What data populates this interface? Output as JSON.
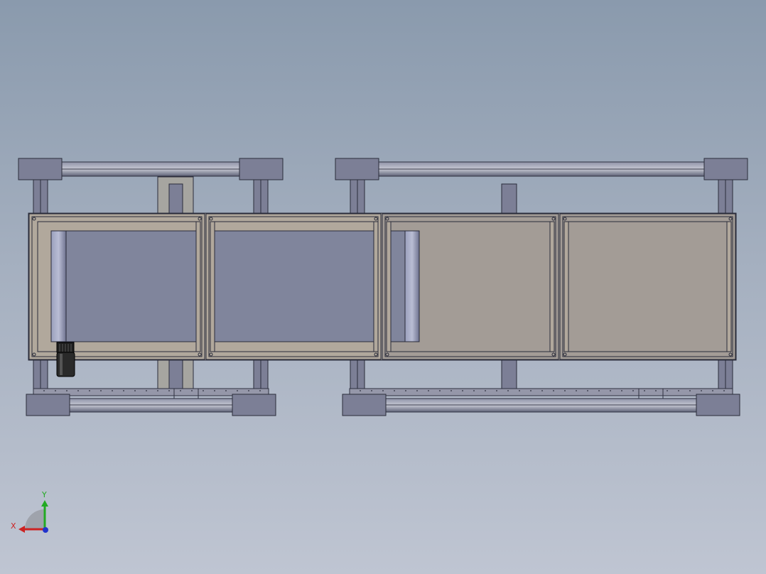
{
  "viewport": {
    "background_top": "#8a9aad",
    "background_bottom": "#bfc5d2"
  },
  "model": {
    "frame_color": "#7c7f96",
    "panel_border_color": "#b1a89c",
    "roller_section_color": "#80859c",
    "plate_color": "#a39c96",
    "motor_color": "#2a2a2a"
  },
  "triad": {
    "x_label": "X",
    "y_label": "Y",
    "x_color": "#cc2222",
    "y_color": "#22aa22",
    "z_color": "#2233cc"
  }
}
